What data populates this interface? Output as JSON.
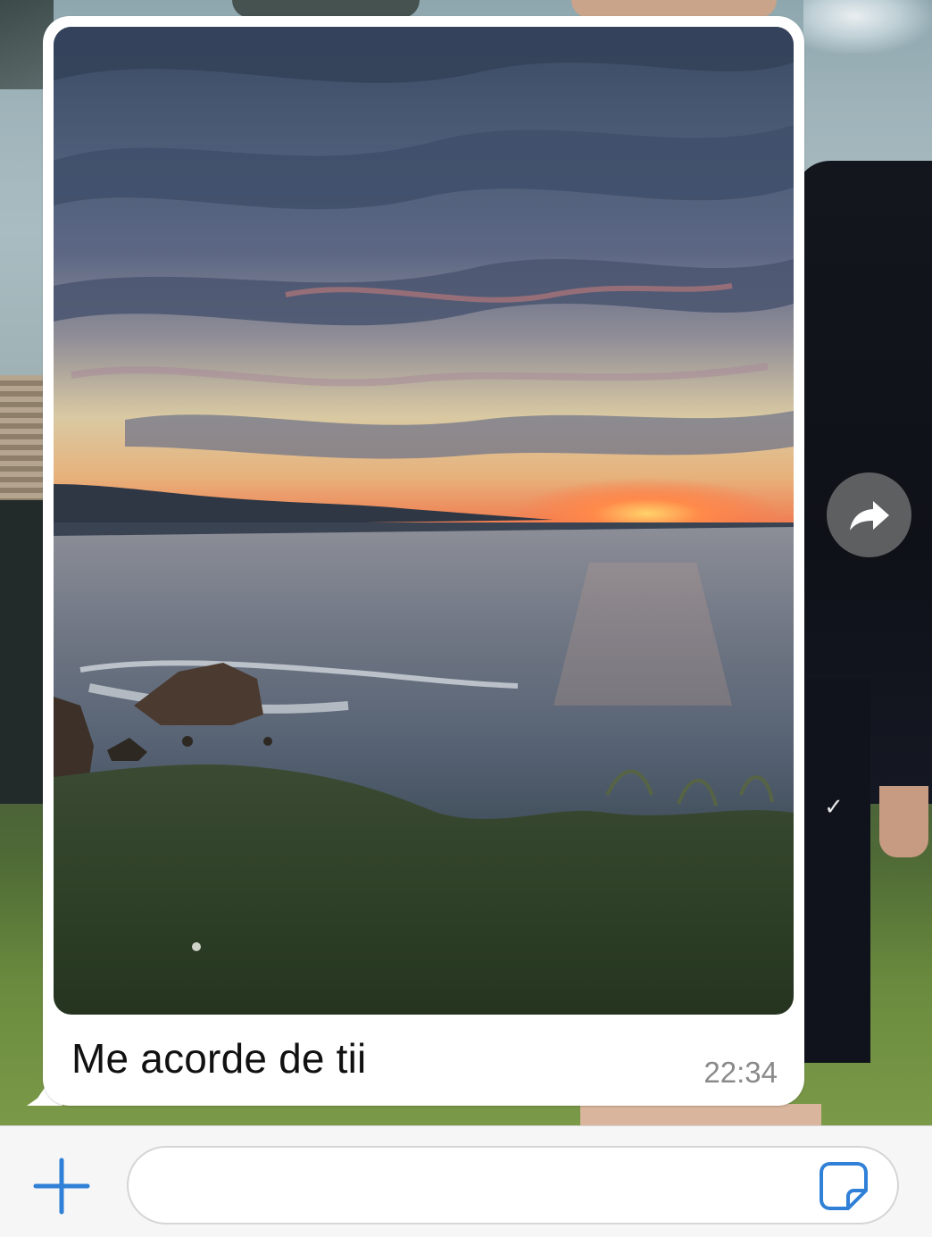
{
  "message": {
    "caption": "Me acorde de tii",
    "time": "22:34",
    "media": "photo-sunset-coast"
  },
  "actions": {
    "forward_icon": "forward-arrow-icon"
  },
  "composer": {
    "attach_icon": "plus-icon",
    "placeholder": "",
    "value": "",
    "sticker_icon": "sticker-icon"
  },
  "colors": {
    "accent": "#2f80d6",
    "bubble": "#ffffff",
    "time_text": "#8a8a8a",
    "bar_background": "#f6f6f6"
  }
}
